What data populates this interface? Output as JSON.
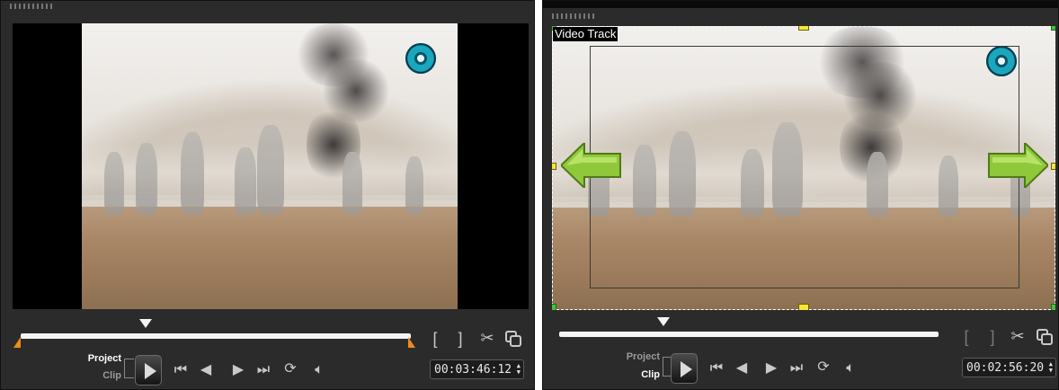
{
  "left": {
    "mode_project": "Project",
    "mode_clip": "Clip",
    "active_mode": "Project",
    "timecode": "00:03:46:12",
    "scrubber_position": 0.33,
    "controls": {
      "mark_in": "[",
      "mark_out": "]"
    }
  },
  "right": {
    "track_label": "Video Track",
    "mode_project": "Project",
    "mode_clip": "Clip",
    "active_mode": "Clip",
    "timecode": "00:02:56:20",
    "scrubber_position": 0.27,
    "controls": {
      "mark_in": "[",
      "mark_out": "]"
    }
  },
  "icons": {
    "start": "go-to-start-icon",
    "prev": "previous-frame-icon",
    "next": "next-frame-icon",
    "end": "go-to-end-icon",
    "repeat": "repeat-icon",
    "volume": "volume-icon",
    "split": "scissors-icon",
    "enlarge": "enlarge-view-icon"
  },
  "colors": {
    "panel_bg": "#2b2b2b",
    "marker": "#f08a1a",
    "handle": "#f7e53a",
    "arrow": "#8fc83a"
  }
}
